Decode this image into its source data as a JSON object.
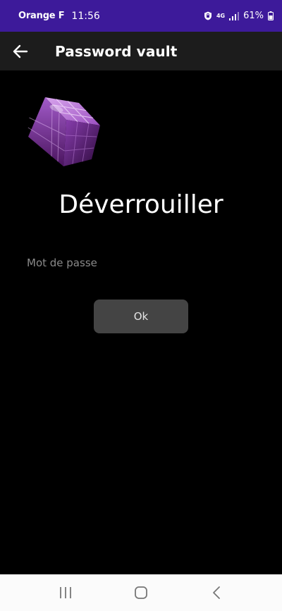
{
  "status_bar": {
    "carrier": "Orange F",
    "time": "11:56",
    "network": "4G",
    "battery": "61%",
    "background_color": "#3d1a9a"
  },
  "app_bar": {
    "title": "Password vault",
    "back_icon": "arrow-left-icon"
  },
  "main": {
    "logo_icon": "purple-cube-icon",
    "heading": "Déverrouiller",
    "password_placeholder": "Mot de passe",
    "ok_label": "Ok"
  },
  "nav_bar": {
    "recents_icon": "recents-icon",
    "home_icon": "home-icon",
    "back_icon": "chevron-left-icon"
  }
}
